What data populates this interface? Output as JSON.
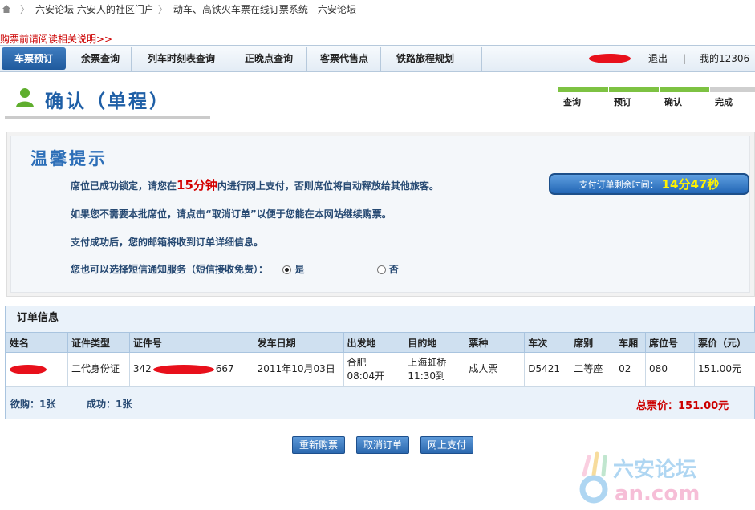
{
  "breadcrumb": {
    "items": [
      "六安论坛 六安人的社区门户",
      "动车、高铁火车票在线订票系统 - 六安论坛"
    ]
  },
  "notice_link": "购票前请阅读相关说明>>",
  "nav": {
    "items": [
      "车票预订",
      "余票查询",
      "列车时刻表查询",
      "正晚点查询",
      "客票代售点",
      "铁路旅程规划"
    ],
    "active_index": 0,
    "logout": "退出",
    "divider": "|",
    "my12306": "我的12306"
  },
  "page_title": "确认（单程）",
  "steps": [
    {
      "label": "查询",
      "color": "#7dc242"
    },
    {
      "label": "预订",
      "color": "#7dc242"
    },
    {
      "label": "确认",
      "color": "#7dc242"
    },
    {
      "label": "完成",
      "color": "#cfcfcf"
    }
  ],
  "tips": {
    "title": "温馨提示",
    "line1_before": "席位已成功锁定，请您在",
    "line1_highlight": "15分钟",
    "line1_after": "内进行网上支付，否则席位将自动释放给其他旅客。",
    "line2": "如果您不需要本批席位，请点击“取消订单”以便于您能在本网站继续购票。",
    "line3": "支付成功后，您的邮箱将收到订单详细信息。",
    "line4": "您也可以选择短信通知服务（短信接收免费）：",
    "option_yes": "是",
    "option_no": "否",
    "selected": "是",
    "timer_label": "支付订单剩余时间：",
    "timer_value": "14分47秒"
  },
  "order": {
    "title": "订单信息",
    "columns": [
      "姓名",
      "证件类型",
      "证件号",
      "发车日期",
      "出发地",
      "目的地",
      "票种",
      "车次",
      "席别",
      "车厢",
      "席位号",
      "票价（元）"
    ],
    "row": {
      "id_type": "二代身份证",
      "id_prefix": "342",
      "id_suffix": "667",
      "date": "2011年10月03日",
      "from_station": "合肥",
      "from_time": "08:04开",
      "to_station": "上海虹桥",
      "to_time": "11:30到",
      "ticket_type": "成人票",
      "train": "D5421",
      "seat_class": "二等座",
      "car": "02",
      "seat_no": "080",
      "price": "151.00元"
    },
    "wanted": "欲购：1张",
    "success": "成功：1张",
    "total": "总票价：151.00元"
  },
  "buttons": {
    "rebook": "重新购票",
    "cancel": "取消订单",
    "pay": "网上支付"
  },
  "watermark": {
    "text1": "六安论坛",
    "text2": "an.com"
  }
}
